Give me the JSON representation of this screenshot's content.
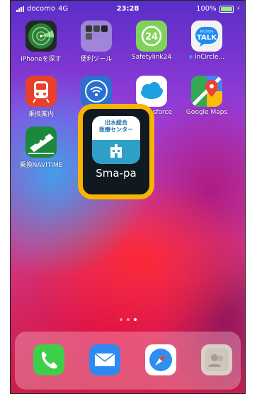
{
  "status_bar": {
    "carrier": "docomo",
    "network": "4G",
    "time": "23:28",
    "battery": "100%"
  },
  "apps": [
    {
      "label": "iPhoneを探す",
      "icon": "radar-icon"
    },
    {
      "label": "便利ツール",
      "icon": "folder-icon"
    },
    {
      "label": "Safetylink24",
      "icon": "safetylink24-icon",
      "icon_text": "24"
    },
    {
      "label": "InCircle...",
      "icon": "incircle-talk-icon",
      "icon_text_small": "InCircle",
      "icon_text": "TALK"
    },
    {
      "label": "乗換案内",
      "icon": "train-icon"
    },
    {
      "label": "",
      "icon": "wifi-icon"
    },
    {
      "label": "lesforce",
      "icon": "salesforce-cloud-icon"
    },
    {
      "label": "Google Maps",
      "icon": "google-maps-icon"
    },
    {
      "label": "乗換NAVITIME",
      "icon": "navitime-train-icon"
    }
  ],
  "highlighted_app": {
    "label": "Sma-pa",
    "icon_line1": "出水総合",
    "icon_line2": "医療センター",
    "icon": "hospital-building-icon"
  },
  "page_dots": 3,
  "active_dot": 3,
  "dock": [
    {
      "name": "phone",
      "icon": "phone-icon"
    },
    {
      "name": "mail",
      "icon": "mail-icon"
    },
    {
      "name": "safari",
      "icon": "compass-icon"
    },
    {
      "name": "contacts",
      "icon": "contacts-icon"
    }
  ],
  "colors": {
    "highlight_border": "#f7b500",
    "incircle_dot": "#4a8cff"
  }
}
